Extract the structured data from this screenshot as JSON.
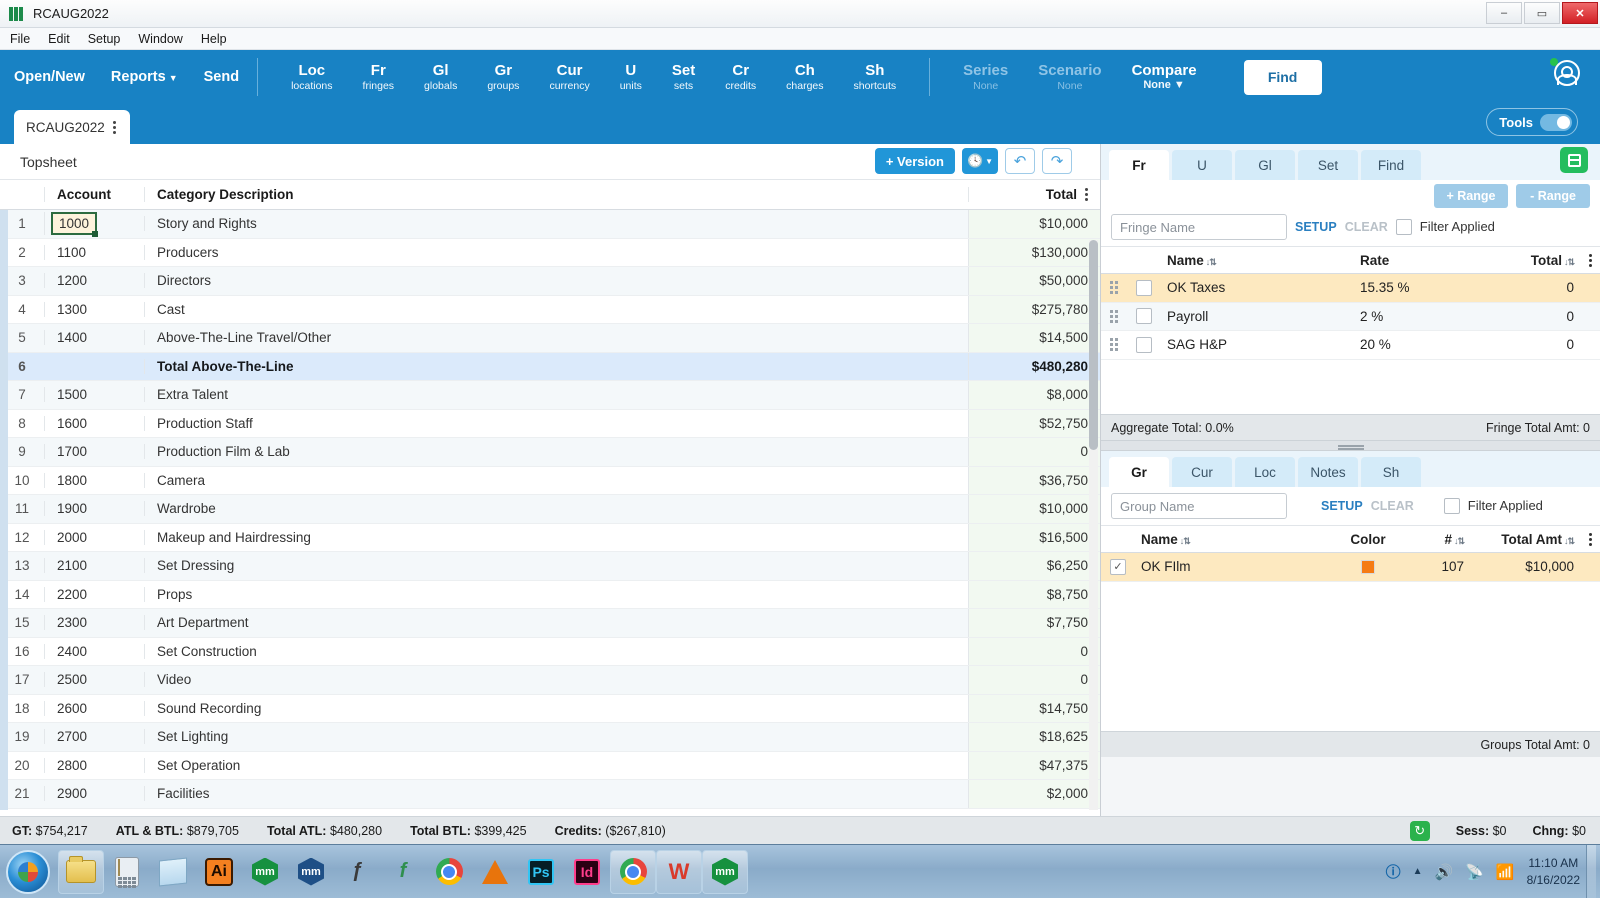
{
  "window": {
    "title": "RCAUG2022",
    "icon": "movie-magic-icon",
    "buttons": {
      "minimize": "–",
      "maximize": "▭",
      "close": "✕"
    }
  },
  "menubar": {
    "items": [
      "File",
      "Edit",
      "Setup",
      "Window",
      "Help"
    ]
  },
  "ribbon": {
    "primary": [
      {
        "label": "Open/New",
        "caret": false
      },
      {
        "label": "Reports",
        "caret": true
      },
      {
        "label": "Send",
        "caret": false
      }
    ],
    "modules": [
      {
        "abbr": "Loc",
        "sub": "locations"
      },
      {
        "abbr": "Fr",
        "sub": "fringes"
      },
      {
        "abbr": "Gl",
        "sub": "globals"
      },
      {
        "abbr": "Gr",
        "sub": "groups"
      },
      {
        "abbr": "Cur",
        "sub": "currency"
      },
      {
        "abbr": "U",
        "sub": "units"
      },
      {
        "abbr": "Set",
        "sub": "sets"
      },
      {
        "abbr": "Cr",
        "sub": "credits"
      },
      {
        "abbr": "Ch",
        "sub": "charges"
      },
      {
        "abbr": "Sh",
        "sub": "shortcuts"
      }
    ],
    "context": [
      {
        "abbr": "Series",
        "sub": "None",
        "dim": true,
        "caret": false
      },
      {
        "abbr": "Scenario",
        "sub": "None",
        "dim": true,
        "caret": false
      },
      {
        "abbr": "Compare",
        "sub": "None",
        "dim": false,
        "caret": true
      }
    ],
    "find_label": "Find",
    "tools_label": "Tools",
    "tools_on": true,
    "accent_color": "#1882c4"
  },
  "doc_tab": {
    "label": "RCAUG2022"
  },
  "sheet": {
    "name": "Topsheet",
    "version_button": "+ Version",
    "clock_button": "clock",
    "undo_button": "undo",
    "redo_button": "redo",
    "columns": {
      "row": "",
      "account": "Account",
      "description": "Category Description",
      "total": "Total"
    },
    "rows": [
      {
        "n": "1",
        "account": "1000",
        "desc": "Story and Rights",
        "total": "$10,000",
        "selected": true,
        "is_total": false
      },
      {
        "n": "2",
        "account": "1100",
        "desc": "Producers",
        "total": "$130,000",
        "selected": false,
        "is_total": false
      },
      {
        "n": "3",
        "account": "1200",
        "desc": "Directors",
        "total": "$50,000",
        "selected": false,
        "is_total": false
      },
      {
        "n": "4",
        "account": "1300",
        "desc": "Cast",
        "total": "$275,780",
        "selected": false,
        "is_total": false
      },
      {
        "n": "5",
        "account": "1400",
        "desc": "Above-The-Line Travel/Other",
        "total": "$14,500",
        "selected": false,
        "is_total": false
      },
      {
        "n": "6",
        "account": "",
        "desc": "Total Above-The-Line",
        "total": "$480,280",
        "selected": false,
        "is_total": true
      },
      {
        "n": "7",
        "account": "1500",
        "desc": "Extra Talent",
        "total": "$8,000",
        "selected": false,
        "is_total": false
      },
      {
        "n": "8",
        "account": "1600",
        "desc": "Production Staff",
        "total": "$52,750",
        "selected": false,
        "is_total": false
      },
      {
        "n": "9",
        "account": "1700",
        "desc": "Production Film & Lab",
        "total": "0",
        "selected": false,
        "is_total": false
      },
      {
        "n": "10",
        "account": "1800",
        "desc": "Camera",
        "total": "$36,750",
        "selected": false,
        "is_total": false
      },
      {
        "n": "11",
        "account": "1900",
        "desc": "Wardrobe",
        "total": "$10,000",
        "selected": false,
        "is_total": false
      },
      {
        "n": "12",
        "account": "2000",
        "desc": "Makeup and Hairdressing",
        "total": "$16,500",
        "selected": false,
        "is_total": false
      },
      {
        "n": "13",
        "account": "2100",
        "desc": "Set Dressing",
        "total": "$6,250",
        "selected": false,
        "is_total": false
      },
      {
        "n": "14",
        "account": "2200",
        "desc": "Props",
        "total": "$8,750",
        "selected": false,
        "is_total": false
      },
      {
        "n": "15",
        "account": "2300",
        "desc": "Art Department",
        "total": "$7,750",
        "selected": false,
        "is_total": false
      },
      {
        "n": "16",
        "account": "2400",
        "desc": "Set Construction",
        "total": "0",
        "selected": false,
        "is_total": false
      },
      {
        "n": "17",
        "account": "2500",
        "desc": "Video",
        "total": "0",
        "selected": false,
        "is_total": false
      },
      {
        "n": "18",
        "account": "2600",
        "desc": "Sound Recording",
        "total": "$14,750",
        "selected": false,
        "is_total": false
      },
      {
        "n": "19",
        "account": "2700",
        "desc": "Set Lighting",
        "total": "$18,625",
        "selected": false,
        "is_total": false
      },
      {
        "n": "20",
        "account": "2800",
        "desc": "Set Operation",
        "total": "$47,375",
        "selected": false,
        "is_total": false
      },
      {
        "n": "21",
        "account": "2900",
        "desc": "Facilities",
        "total": "$2,000",
        "selected": false,
        "is_total": false
      }
    ]
  },
  "fringe_panel": {
    "tabs": [
      {
        "label": "Fr",
        "active": true
      },
      {
        "label": "U",
        "active": false
      },
      {
        "label": "Gl",
        "active": false
      },
      {
        "label": "Set",
        "active": false
      },
      {
        "label": "Find",
        "active": false
      }
    ],
    "add_range": "+ Range",
    "remove_range": "- Range",
    "search_placeholder": "Fringe Name",
    "setup_link": "SETUP",
    "clear_link": "CLEAR",
    "filter_label": "Filter Applied",
    "columns": {
      "name": "Name",
      "rate": "Rate",
      "total": "Total"
    },
    "rows": [
      {
        "name": "OK Taxes",
        "rate": "15.35 %",
        "total": "0",
        "checked": false,
        "selected": true
      },
      {
        "name": "Payroll",
        "rate": "2 %",
        "total": "0",
        "checked": false,
        "selected": false
      },
      {
        "name": "SAG H&P",
        "rate": "20 %",
        "total": "0",
        "checked": false,
        "selected": false
      }
    ],
    "footer_left": "Aggregate Total: 0.0%",
    "footer_left_bold": "Aggregate Total",
    "footer_right": "Fringe Total Amt: 0"
  },
  "group_panel": {
    "tabs": [
      {
        "label": "Gr",
        "active": true
      },
      {
        "label": "Cur",
        "active": false
      },
      {
        "label": "Loc",
        "active": false
      },
      {
        "label": "Notes",
        "active": false
      },
      {
        "label": "Sh",
        "active": false
      }
    ],
    "search_placeholder": "Group Name",
    "setup_link": "SETUP",
    "clear_link": "CLEAR",
    "filter_label": "Filter Applied",
    "columns": {
      "name": "Name",
      "color": "Color",
      "count": "#",
      "total": "Total Amt"
    },
    "rows": [
      {
        "name": "OK FIlm",
        "color": "#f57b14",
        "count": "107",
        "total": "$10,000",
        "checked": true,
        "selected": true
      }
    ],
    "footer_right": "Groups Total Amt: 0"
  },
  "statusbar": {
    "items": [
      {
        "label": "GT:",
        "value": "$754,217"
      },
      {
        "label": "ATL & BTL:",
        "value": "$879,705"
      },
      {
        "label": "Total ATL:",
        "value": "$480,280"
      },
      {
        "label": "Total BTL:",
        "value": "$399,425"
      },
      {
        "label": "Credits:",
        "value": "($267,810)"
      }
    ],
    "session": {
      "label": "Sess:",
      "value": "$0"
    },
    "change": {
      "label": "Chng:",
      "value": "$0"
    }
  },
  "taskbar": {
    "start": "start-orb",
    "items": [
      {
        "name": "file-explorer-icon",
        "kind": "folder",
        "boxed": true
      },
      {
        "name": "calculator-icon",
        "kind": "calc",
        "boxed": false
      },
      {
        "name": "notepad-icon",
        "kind": "note",
        "boxed": false
      },
      {
        "name": "illustrator-icon",
        "kind": "ai",
        "boxed": false,
        "label": "Ai"
      },
      {
        "name": "movie-magic-icon",
        "kind": "hexg",
        "boxed": false,
        "label": "mm"
      },
      {
        "name": "movie-magic-blue-icon",
        "kind": "hexb",
        "boxed": false,
        "label": "mm"
      },
      {
        "name": "fontlab-icon",
        "kind": "fx",
        "boxed": false,
        "label": "ƒ"
      },
      {
        "name": "fontographer-icon",
        "kind": "fx2",
        "boxed": false,
        "label": "f"
      },
      {
        "name": "chrome-icon",
        "kind": "chrome",
        "boxed": false
      },
      {
        "name": "vlc-icon",
        "kind": "vlc",
        "boxed": false
      },
      {
        "name": "photoshop-icon",
        "kind": "ps",
        "boxed": false,
        "label": "Ps"
      },
      {
        "name": "indesign-icon",
        "kind": "id",
        "boxed": false,
        "label": "Id"
      },
      {
        "name": "chrome-window-icon",
        "kind": "chrome",
        "boxed": true
      },
      {
        "name": "wps-office-icon",
        "kind": "w",
        "boxed": true,
        "label": "W"
      },
      {
        "name": "movie-magic-window-icon",
        "kind": "hexg",
        "boxed": true,
        "label": "mm"
      }
    ],
    "tray": {
      "help": "?",
      "expand": "▲",
      "volume": "volume-icon",
      "network": "network-error-icon",
      "signal": "signal-icon",
      "time": "11:10 AM",
      "date": "8/16/2022"
    }
  }
}
